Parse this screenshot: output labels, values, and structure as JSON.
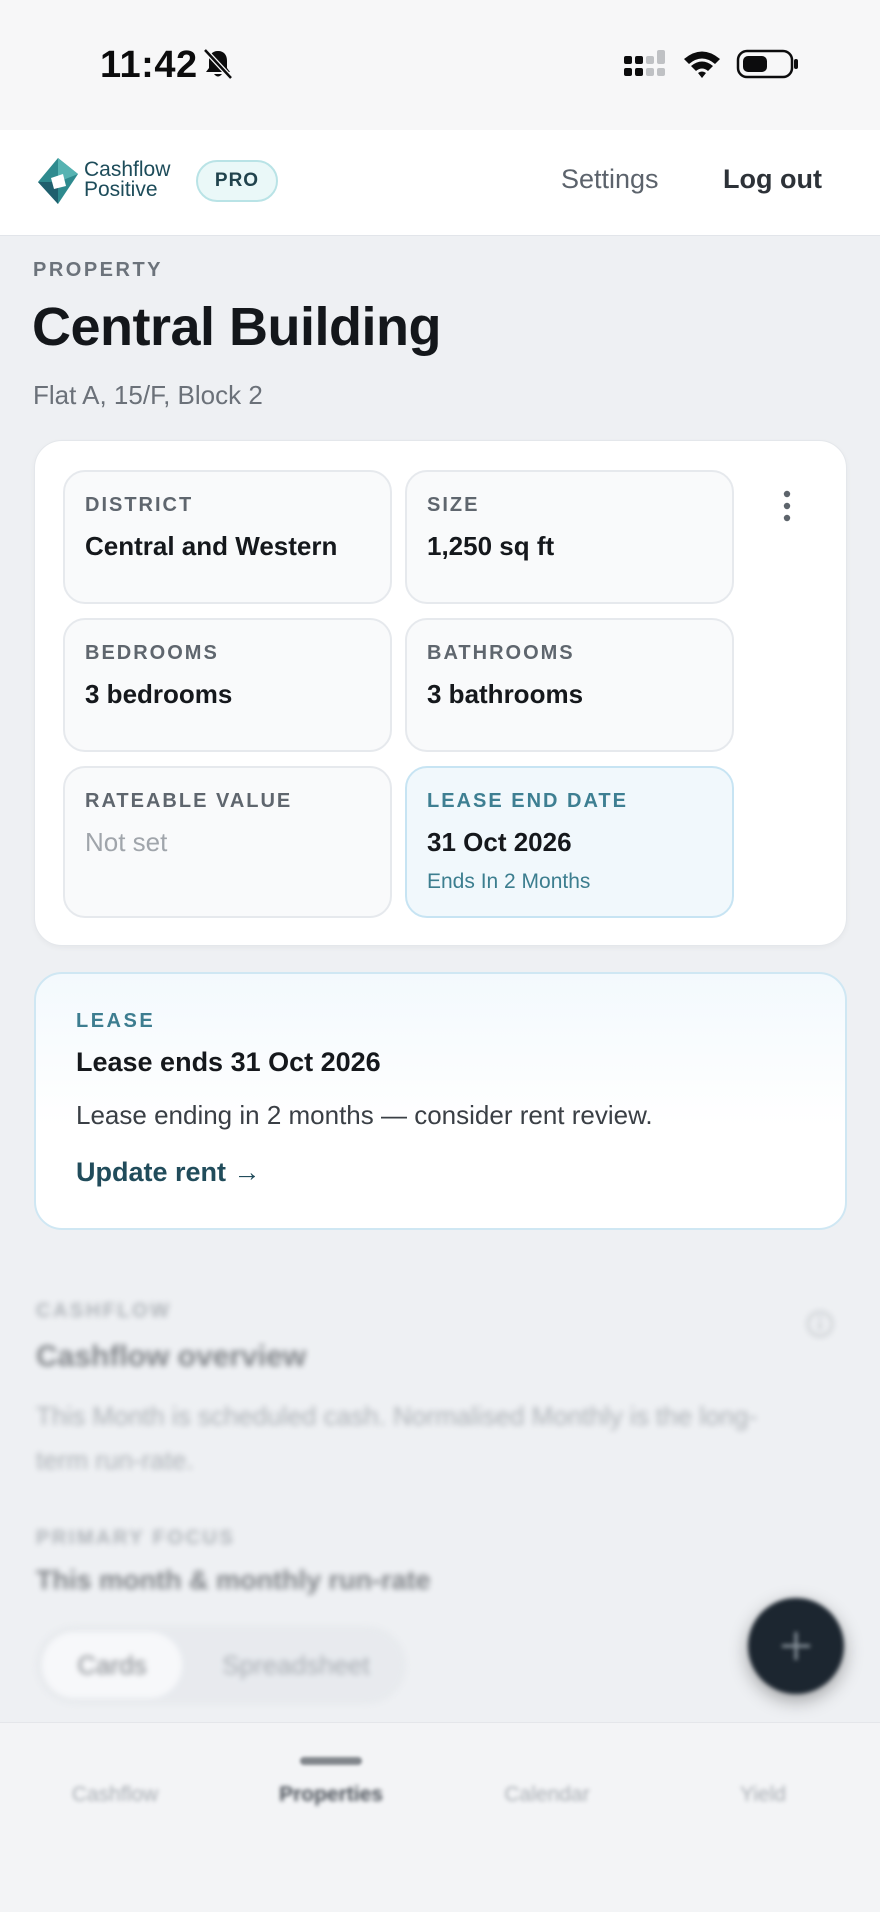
{
  "status_bar": {
    "time": "11:42"
  },
  "header": {
    "logo_line1": "Cashflow",
    "logo_line2": "Positive",
    "badge": "PRO",
    "settings_label": "Settings",
    "logout_label": "Log out"
  },
  "property": {
    "eyebrow": "PROPERTY",
    "name": "Central Building",
    "address": "Flat A, 15/F, Block 2"
  },
  "details": [
    {
      "label": "DISTRICT",
      "value": "Central and Western"
    },
    {
      "label": "SIZE",
      "value": "1,250 sq ft"
    },
    {
      "label": "BEDROOMS",
      "value": "3 bedrooms"
    },
    {
      "label": "BATHROOMS",
      "value": "3 bathrooms"
    },
    {
      "label": "RATEABLE VALUE",
      "value": "Not set"
    },
    {
      "label": "LEASE END DATE",
      "value": "31 Oct 2026",
      "note": "Ends In 2 Months"
    }
  ],
  "lease": {
    "eyebrow": "LEASE",
    "title": "Lease ends 31 Oct 2026",
    "description": "Lease ending in 2 months — consider rent review.",
    "action": "Update rent →"
  },
  "cashflow": {
    "eyebrow": "CASHFLOW",
    "title": "Cashflow overview",
    "description": "This Month is scheduled cash. Normalised Monthly is the long-term run-rate.",
    "focus_eyebrow": "PRIMARY FOCUS",
    "focus_value": "This month & monthly run-rate",
    "view_tabs": [
      "Cards",
      "Spreadsheet"
    ]
  },
  "tab_bar": {
    "tabs": [
      "Cashflow",
      "Properties",
      "Calendar",
      "Yield"
    ],
    "active": "Properties"
  },
  "colors": {
    "accent": "#3d7d90",
    "brand": "#1d4c5a",
    "highlight_bg": "#f1f8fc"
  }
}
